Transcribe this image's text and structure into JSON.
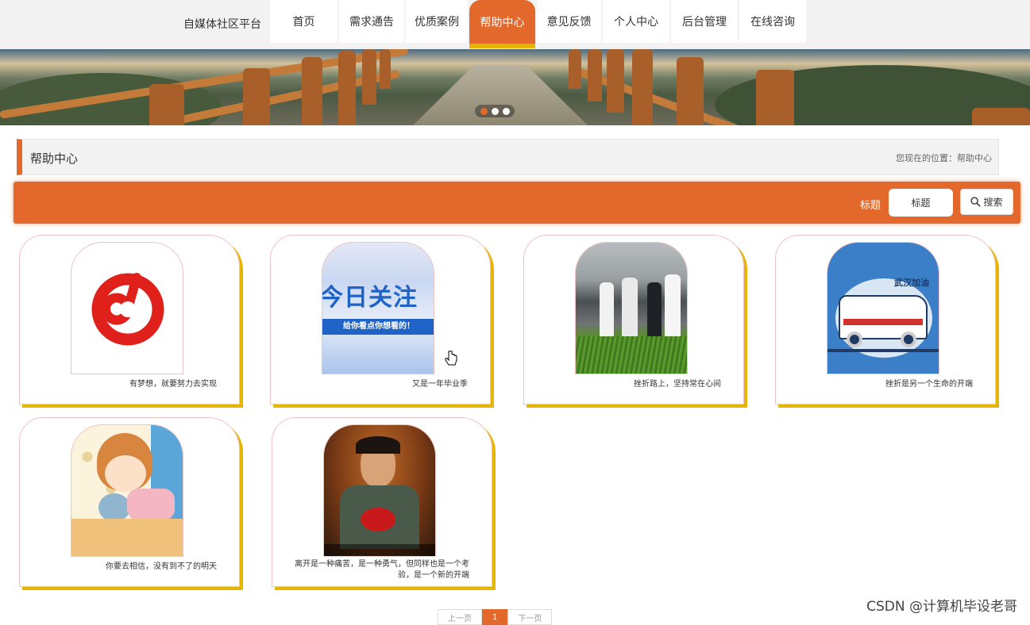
{
  "brand": "自媒体社区平台",
  "nav": [
    {
      "label": "首页",
      "active": false
    },
    {
      "label": "需求通告",
      "active": false
    },
    {
      "label": "优质案例",
      "active": false
    },
    {
      "label": "帮助中心",
      "active": true
    },
    {
      "label": "意见反馈",
      "active": false
    },
    {
      "label": "个人中心",
      "active": false
    },
    {
      "label": "后台管理",
      "active": false
    },
    {
      "label": "在线咨询",
      "active": false
    }
  ],
  "section": {
    "title": "帮助中心",
    "breadcrumb": "您现在的位置：帮助中心"
  },
  "search": {
    "label": "标题",
    "placeholder": "标题",
    "button": "搜索"
  },
  "cards": [
    {
      "title": "有梦想，就要努力去实现",
      "image": "netease-music-logo"
    },
    {
      "title": "又是一年毕业季",
      "image": "today-focus-banner",
      "image_text": [
        "今日关注",
        "给你看点你想看的！"
      ]
    },
    {
      "title": "挫折路上，坚持常在心间",
      "image": "officials-in-rice-field"
    },
    {
      "title": "挫折是另一个生命的开端",
      "image": "ambulance-illustration",
      "image_text": [
        "武汉加油"
      ]
    },
    {
      "title": "你要去相信，没有到不了的明天",
      "image": "sleeping-girl-illustration"
    },
    {
      "title": "离开是一种痛苦，是一种勇气，但同样也是一个考验，是一个新的开端",
      "image": "movie-still"
    }
  ],
  "pagination": {
    "prev": "上一页",
    "current": "1",
    "next": "下一页"
  },
  "watermark": "CSDN @计算机毕设老哥",
  "colors": {
    "accent": "#e2692b",
    "shadow_yellow": "#e7b400"
  }
}
